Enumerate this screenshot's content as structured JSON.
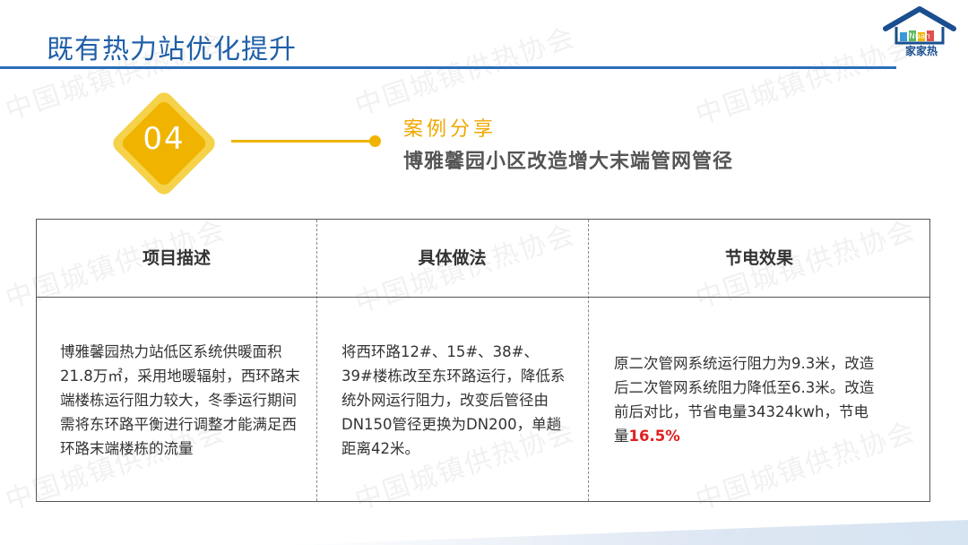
{
  "header": {
    "title": "既有热力站优化提升",
    "logo_text": "家家热",
    "logo_badge": "Nuan"
  },
  "watermark": "中国城镇供热协会",
  "case": {
    "number": "04",
    "label": "案例分享",
    "title": "博雅馨园小区改造增大末端管网管径"
  },
  "table": {
    "headers": [
      "项目描述",
      "具体做法",
      "节电效果"
    ],
    "description": "博雅馨园热力站低区系统供暖面积21.8万㎡，采用地暖辐射，西环路末端楼栋运行阻力较大，冬季运行期间需将东环路平衡进行调整才能满足西环路末端楼栋的流量",
    "method": "将西环路12#、15#、38#、39#楼栋改至东环路运行，降低系统外网运行阻力，改变后管径由DN150管径更换为DN200，单趟距离42米。",
    "effect_text": "原二次管网系统运行阻力为9.3米，改造后二次管网系统阻力降低至6.3米。改造前后对比，节省电量34324kwh，节电量",
    "effect_highlight": "16.5%"
  },
  "colors": {
    "title_blue": "#1f5fa8",
    "accent_yellow": "#f0b400",
    "highlight_red": "#e02020"
  }
}
